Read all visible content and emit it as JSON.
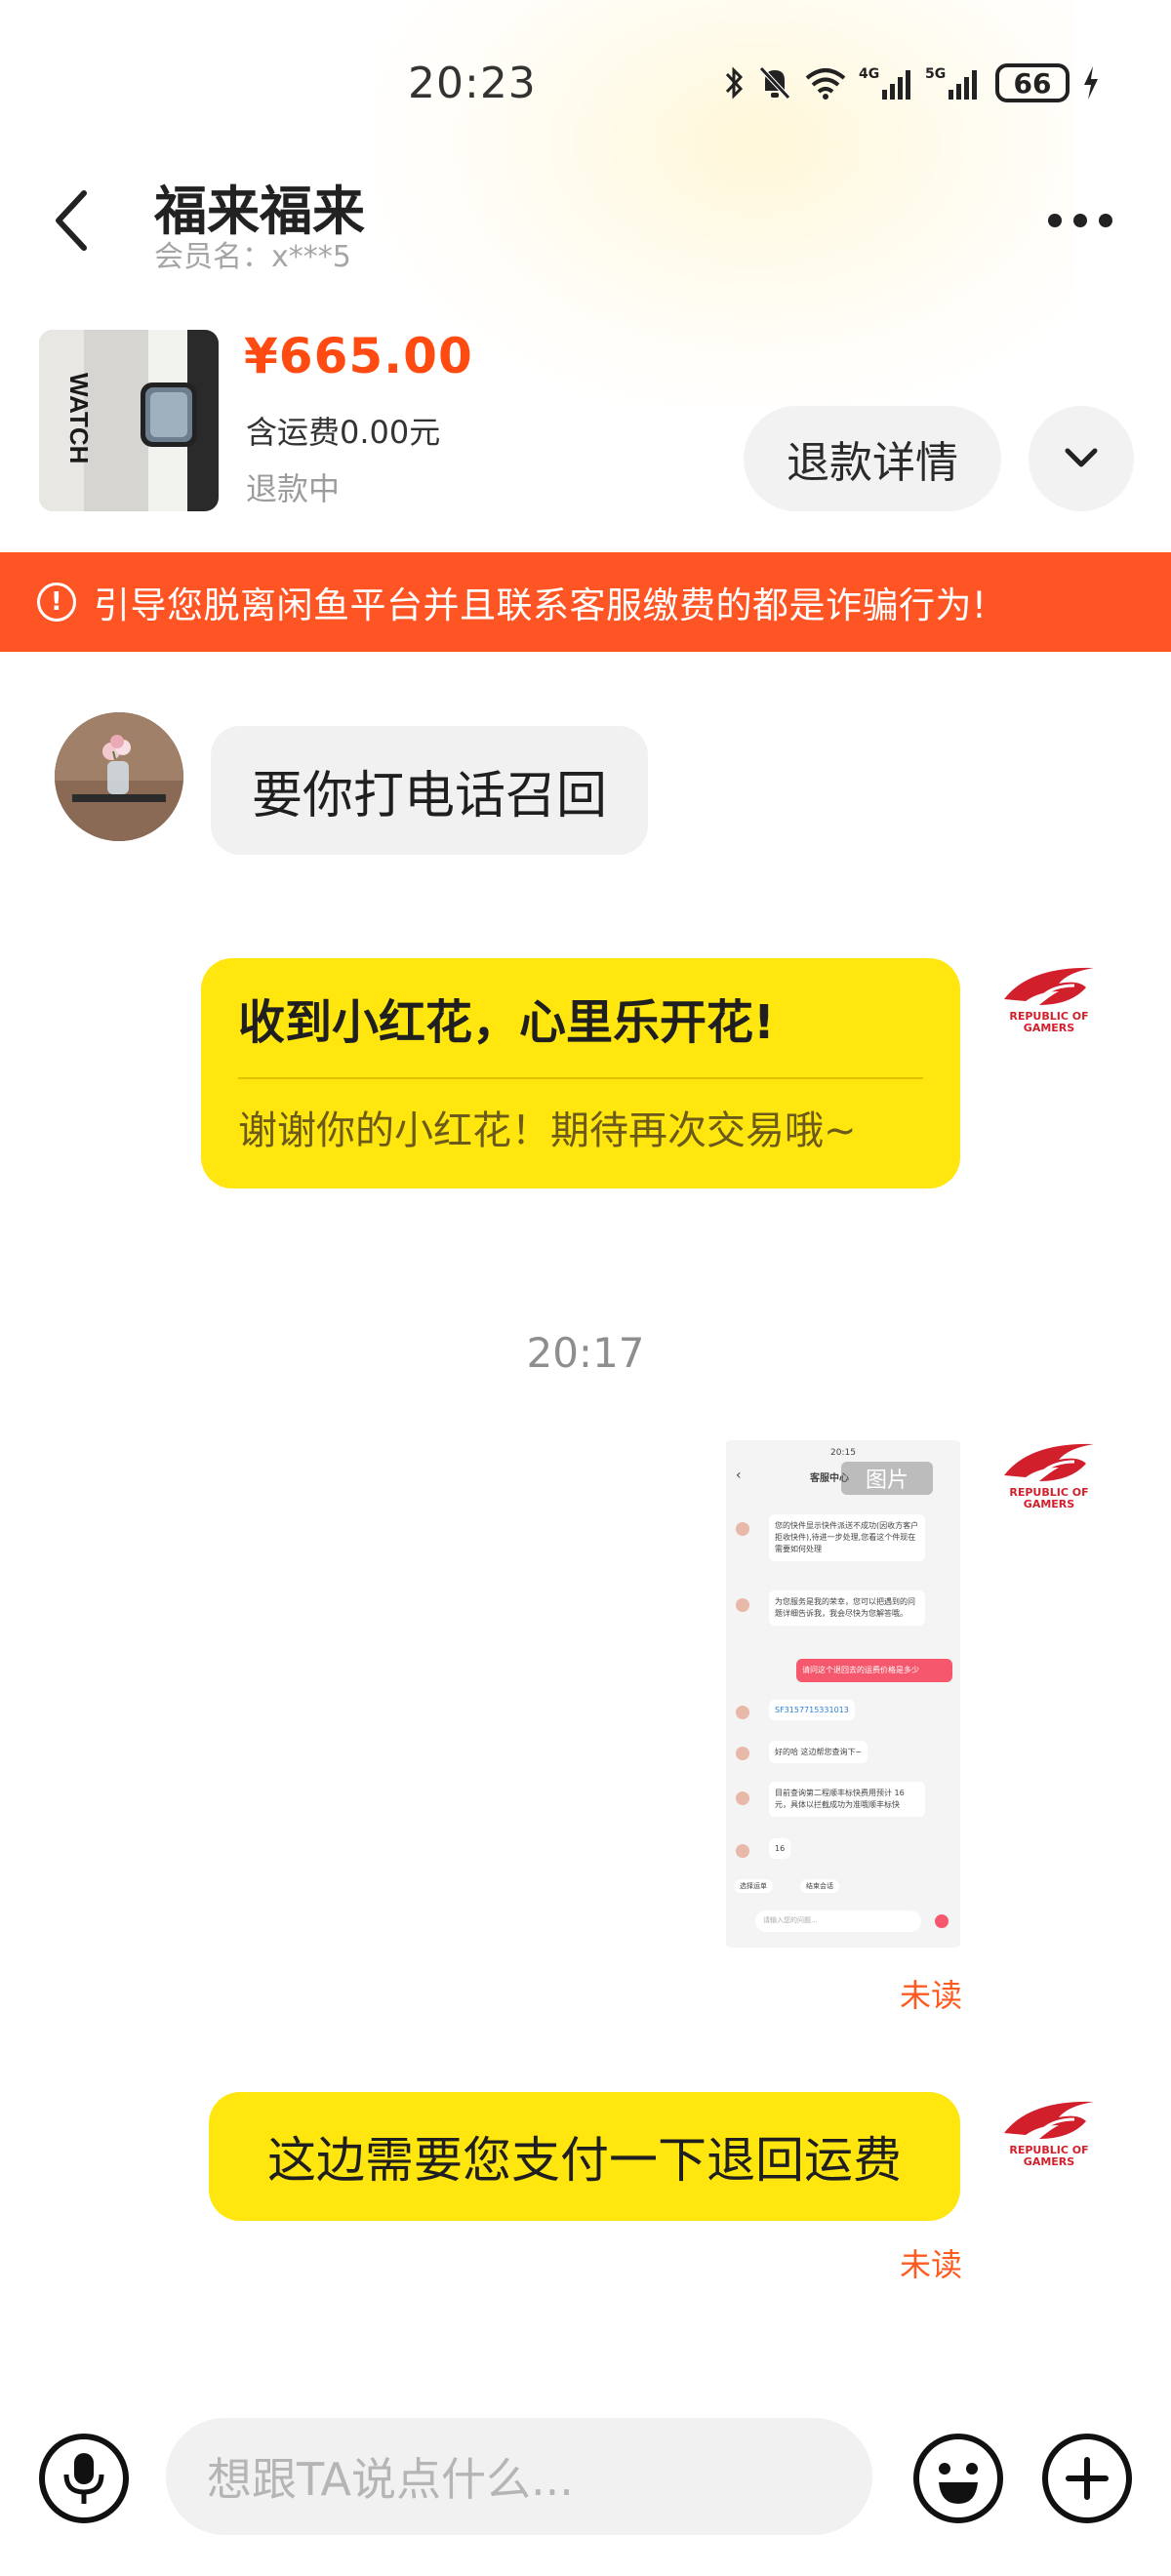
{
  "status_bar": {
    "time": "20:23",
    "battery": "66",
    "network_1": "4G",
    "network_2": "5G"
  },
  "header": {
    "title": "福来福来",
    "subtitle": "会员名：x***5"
  },
  "product": {
    "price": "¥665.00",
    "shipping": "含运费0.00元",
    "status": "退款中",
    "image_text": "WATCH",
    "refund_button": "退款详情"
  },
  "warning": {
    "text": "引导您脱离闲鱼平台并且联系客服缴费的都是诈骗行为!"
  },
  "messages": {
    "incoming_1": "要你打电话召回",
    "card_title": "收到小红花，心里乐开花!",
    "card_subtitle": "谢谢你的小红花！期待再次交易哦~",
    "timestamp": "20:17",
    "image_unread": "未读",
    "outgoing_2": "这边需要您支付一下退回运费",
    "outgoing_2_unread": "未读"
  },
  "rog_avatar": {
    "line1": "REPUBLIC OF",
    "line2": "GAMERS"
  },
  "image_preview": {
    "time": "20:15",
    "title": "客服中心",
    "badge": "图片",
    "msg1": "您的快件显示快件派送不成功(因收方客户拒收快件),待进一步处理,您看这个件现在需要如何处理",
    "msg2": "为您服务是我的荣幸，您可以把遇到的问题详细告诉我，我会尽快为您解答哦。",
    "msg3": "请问这个退回去的运费价格是多少",
    "msg4": "SF3157715331013",
    "msg5": "好的哈 这边帮您查询下~",
    "msg6": "目前查询第二程顺丰标快费用预计 16元，具体以拦截成功为准哦顺丰标快",
    "msg7": "16",
    "btn1": "选择运单",
    "btn2": "结束会话",
    "input": "请输入您的问题..."
  },
  "input_bar": {
    "placeholder": "想跟TA说点什么..."
  },
  "colors": {
    "accent_orange": "#ff5524",
    "price_red": "#ff4b12",
    "bubble_yellow": "#ffe60f",
    "bubble_gray": "#f1f1f1"
  },
  "icons": {
    "back": "chevron-left-icon",
    "more": "more-dots-icon",
    "dropdown": "chevron-down-icon",
    "warning": "alert-circle-icon",
    "mic": "microphone-icon",
    "emoji": "emoji-icon",
    "plus": "plus-icon"
  }
}
